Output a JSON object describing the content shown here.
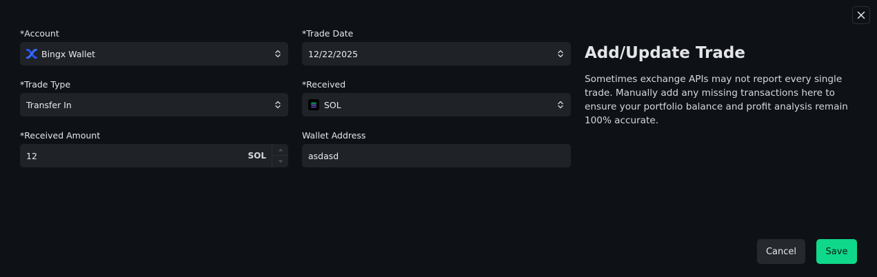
{
  "form": {
    "account": {
      "label": "*Account",
      "value": "Bingx Wallet",
      "icon": "bingx-logo-icon"
    },
    "trade_date": {
      "label": "*Trade Date",
      "value": "12/22/2025"
    },
    "trade_type": {
      "label": "*Trade Type",
      "value": "Transfer In"
    },
    "received": {
      "label": "*Received",
      "value": "SOL",
      "icon": "solana-icon"
    },
    "received_amount": {
      "label": "*Received Amount",
      "value": "12",
      "unit": "SOL"
    },
    "wallet_address": {
      "label": "Wallet Address",
      "value": "asdasd"
    }
  },
  "info": {
    "title": "Add/Update Trade",
    "body": "Sometimes exchange APIs may not report every single trade. Manually add any missing transactions here to ensure your portfolio balance and profit analysis remain 100% accurate."
  },
  "actions": {
    "cancel_label": "Cancel",
    "save_label": "Save"
  },
  "colors": {
    "background": "#0e1115",
    "field_background": "#1f2227",
    "save_accent": "#10d88a",
    "bingx_blue": "#2a54f5"
  }
}
